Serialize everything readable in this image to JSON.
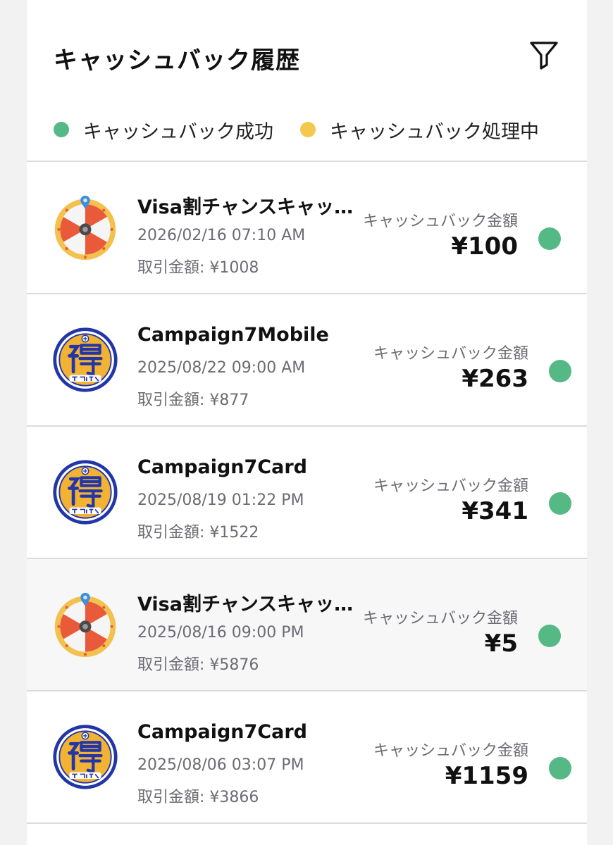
{
  "header": {
    "title": "キャッシュバック履歴",
    "filter_icon": "filter-icon"
  },
  "legend": [
    {
      "label": "キャッシュバック成功",
      "color": "#55b985"
    },
    {
      "label": "キャッシュバック処理中",
      "color": "#f2c94c"
    }
  ],
  "colors": {
    "success": "#55b985",
    "processing": "#f2c94c"
  },
  "rows": [
    {
      "icon": "roulette-wheel-icon",
      "name": "Visa割チャンスキャッシュバック",
      "date": "2026/02/16 07:10 AM",
      "tx_label": "取引金額: ",
      "tx_value": "¥1008",
      "amount_label": "キャッシュバック金額",
      "amount": "¥100",
      "status": "success"
    },
    {
      "icon": "toku-daore-badge-icon",
      "name": "Campaign7Mobile",
      "date": "2025/08/22 09:00 AM",
      "tx_label": "取引金額: ",
      "tx_value": "¥877",
      "amount_label": "キャッシュバック金額",
      "amount": "¥263",
      "status": "success"
    },
    {
      "icon": "toku-daore-badge-icon",
      "name": "Campaign7Card",
      "date": "2025/08/19 01:22 PM",
      "tx_label": "取引金額: ",
      "tx_value": "¥1522",
      "amount_label": "キャッシュバック金額",
      "amount": "¥341",
      "status": "success"
    },
    {
      "icon": "roulette-wheel-icon",
      "name": "Visa割チャンスキャッシュバック",
      "date": "2025/08/16 09:00 PM",
      "tx_label": "取引金額: ",
      "tx_value": "¥5876",
      "amount_label": "キャッシュバック金額",
      "amount": "¥5",
      "status": "success"
    },
    {
      "icon": "toku-daore-badge-icon",
      "name": "Campaign7Card",
      "date": "2025/08/06 03:07 PM",
      "tx_label": "取引金額: ",
      "tx_value": "¥3866",
      "amount_label": "キャッシュバック金額",
      "amount": "¥1159",
      "status": "success"
    }
  ]
}
